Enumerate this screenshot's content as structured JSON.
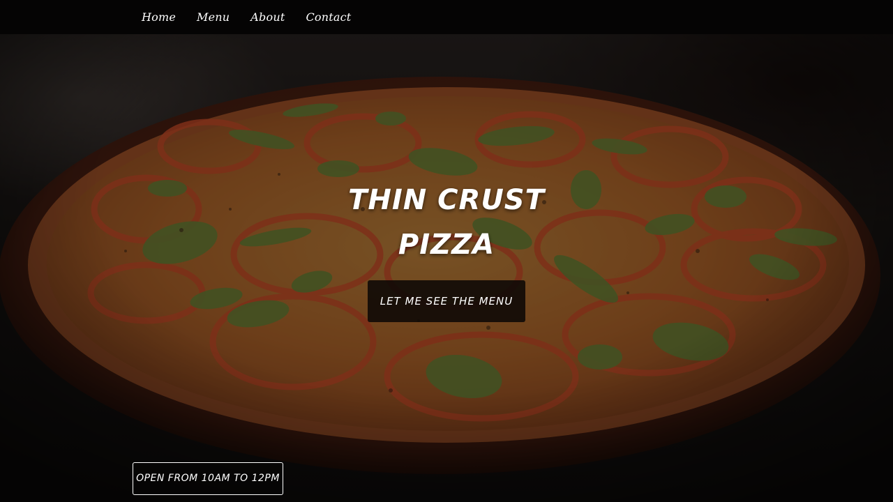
{
  "nav": {
    "items": [
      {
        "label": "Home"
      },
      {
        "label": "Menu"
      },
      {
        "label": "About"
      },
      {
        "label": "Contact"
      }
    ]
  },
  "hero": {
    "title": "THIN CRUST PIZZA",
    "cta_label": "LET ME SEE THE MENU",
    "background_image": "pizza-photo"
  },
  "hours": {
    "text": "OPEN FROM 10AM TO 12PM"
  },
  "colors": {
    "nav_background": "#050404",
    "text": "#ffffff",
    "cta_background": "#0c0806"
  }
}
